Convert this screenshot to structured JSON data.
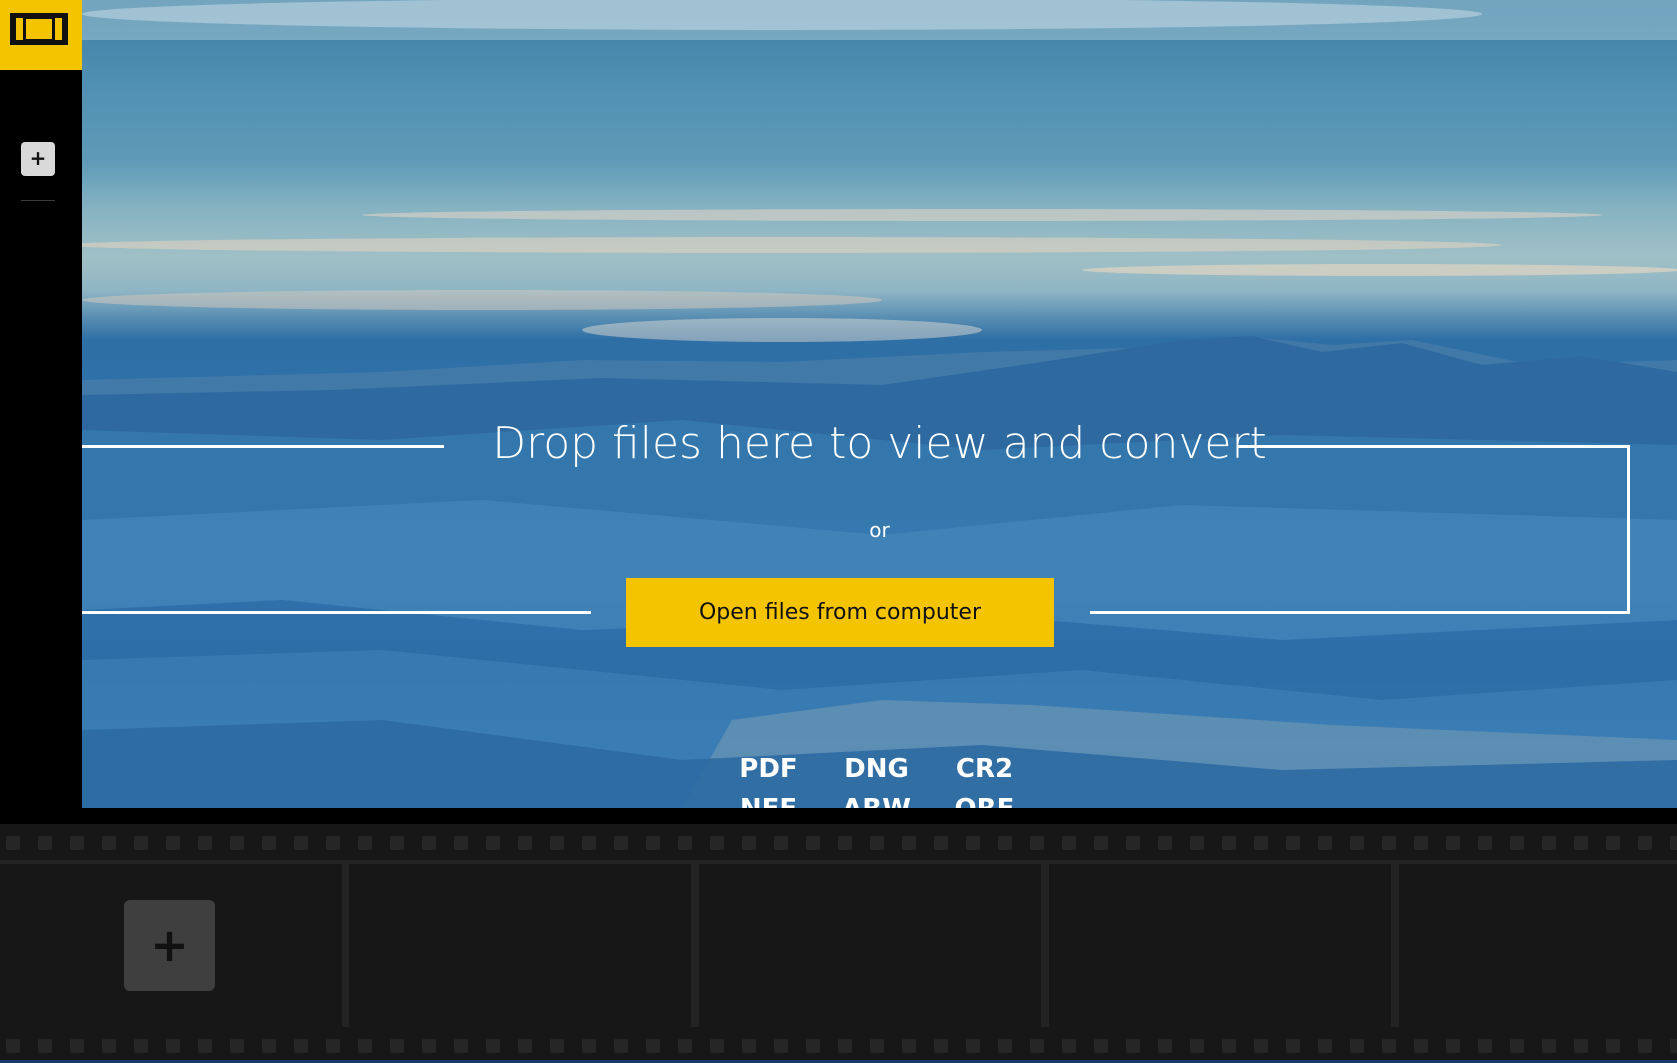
{
  "sidebar": {
    "logo_icon": "film-strip-icon",
    "add_label": "+",
    "add_icon": "plus-icon"
  },
  "hero": {
    "title": "Drop files here to view and convert",
    "or_label": "or",
    "open_button_label": "Open files from computer",
    "formats": [
      "PDF",
      "DNG",
      "CR2",
      "NEF",
      "ARW",
      "ORF"
    ]
  },
  "filmstrip": {
    "add_label": "+",
    "add_icon": "plus-icon",
    "frame_count": 5
  },
  "colors": {
    "accent": "#f5c400",
    "sidebar_bg": "#000000",
    "strip_bg": "#1c1c1c"
  }
}
